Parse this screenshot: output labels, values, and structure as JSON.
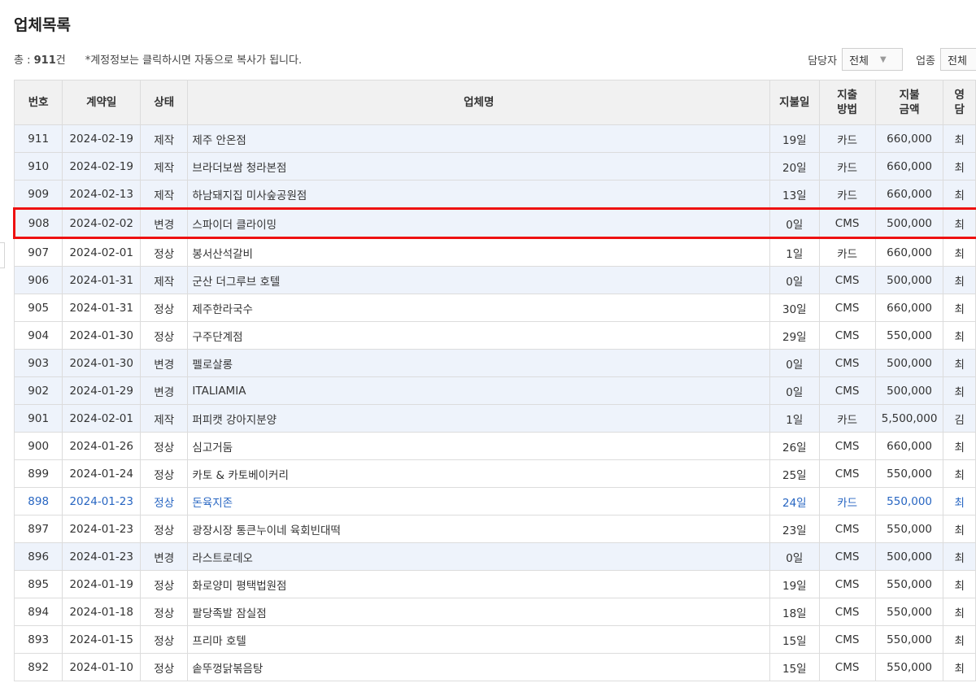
{
  "page_title": "업체목록",
  "summary": {
    "total_label": "총 : ",
    "total_count": "911",
    "total_unit": "건",
    "note": "*계정정보는 클릭하시면 자동으로 복사가 됩니다."
  },
  "filters": {
    "manager_label": "담당자",
    "manager_value": "전체",
    "industry_label": "업종",
    "industry_value": "전체"
  },
  "table": {
    "headers": [
      "번호",
      "계약일",
      "상태",
      "업체명",
      "지불일",
      "지출\n방법",
      "지불\n금액",
      "영\n담"
    ],
    "rows": [
      {
        "no": "911",
        "date": "2024-02-19",
        "status": "제작",
        "name": "제주 안온점",
        "payday": "19일",
        "method": "카드",
        "amount": "660,000",
        "manager": "최"
      },
      {
        "no": "910",
        "date": "2024-02-19",
        "status": "제작",
        "name": "브라더보쌈 청라본점",
        "payday": "20일",
        "method": "카드",
        "amount": "660,000",
        "manager": "최"
      },
      {
        "no": "909",
        "date": "2024-02-13",
        "status": "제작",
        "name": "하남돼지집 미사숲공원점",
        "payday": "13일",
        "method": "카드",
        "amount": "660,000",
        "manager": "최"
      },
      {
        "no": "908",
        "date": "2024-02-02",
        "status": "변경",
        "name": "스파이더 클라이밍",
        "payday": "0일",
        "method": "CMS",
        "amount": "500,000",
        "manager": "최"
      },
      {
        "no": "907",
        "date": "2024-02-01",
        "status": "정상",
        "name": "봉서산석갈비",
        "payday": "1일",
        "method": "카드",
        "amount": "660,000",
        "manager": "최"
      },
      {
        "no": "906",
        "date": "2024-01-31",
        "status": "제작",
        "name": "군산 더그루브 호텔",
        "payday": "0일",
        "method": "CMS",
        "amount": "500,000",
        "manager": "최"
      },
      {
        "no": "905",
        "date": "2024-01-31",
        "status": "정상",
        "name": "제주한라국수",
        "payday": "30일",
        "method": "CMS",
        "amount": "660,000",
        "manager": "최"
      },
      {
        "no": "904",
        "date": "2024-01-30",
        "status": "정상",
        "name": "구주단계점",
        "payday": "29일",
        "method": "CMS",
        "amount": "550,000",
        "manager": "최"
      },
      {
        "no": "903",
        "date": "2024-01-30",
        "status": "변경",
        "name": "펠로살롱",
        "payday": "0일",
        "method": "CMS",
        "amount": "500,000",
        "manager": "최"
      },
      {
        "no": "902",
        "date": "2024-01-29",
        "status": "변경",
        "name": "ITALIAMIA",
        "payday": "0일",
        "method": "CMS",
        "amount": "500,000",
        "manager": "최"
      },
      {
        "no": "901",
        "date": "2024-02-01",
        "status": "제작",
        "name": "퍼피캣 강아지분양",
        "payday": "1일",
        "method": "카드",
        "amount": "5,500,000",
        "manager": "김"
      },
      {
        "no": "900",
        "date": "2024-01-26",
        "status": "정상",
        "name": "심고거둠",
        "payday": "26일",
        "method": "CMS",
        "amount": "660,000",
        "manager": "최"
      },
      {
        "no": "899",
        "date": "2024-01-24",
        "status": "정상",
        "name": "카토 & 카토베이커리",
        "payday": "25일",
        "method": "CMS",
        "amount": "550,000",
        "manager": "최"
      },
      {
        "no": "898",
        "date": "2024-01-23",
        "status": "정상",
        "name": "돈육지존",
        "payday": "24일",
        "method": "카드",
        "amount": "550,000",
        "manager": "최"
      },
      {
        "no": "897",
        "date": "2024-01-23",
        "status": "정상",
        "name": "광장시장 통큰누이네 육회빈대떡",
        "payday": "23일",
        "method": "CMS",
        "amount": "550,000",
        "manager": "최"
      },
      {
        "no": "896",
        "date": "2024-01-23",
        "status": "변경",
        "name": "라스트로데오",
        "payday": "0일",
        "method": "CMS",
        "amount": "500,000",
        "manager": "최"
      },
      {
        "no": "895",
        "date": "2024-01-19",
        "status": "정상",
        "name": "화로양미 평택법원점",
        "payday": "19일",
        "method": "CMS",
        "amount": "550,000",
        "manager": "최"
      },
      {
        "no": "894",
        "date": "2024-01-18",
        "status": "정상",
        "name": "팔당족발 잠실점",
        "payday": "18일",
        "method": "CMS",
        "amount": "550,000",
        "manager": "최"
      },
      {
        "no": "893",
        "date": "2024-01-15",
        "status": "정상",
        "name": "프리마 호텔",
        "payday": "15일",
        "method": "CMS",
        "amount": "550,000",
        "manager": "최"
      },
      {
        "no": "892",
        "date": "2024-01-10",
        "status": "정상",
        "name": "솥뚜껑닭볶음탕",
        "payday": "15일",
        "method": "CMS",
        "amount": "550,000",
        "manager": "최"
      }
    ]
  },
  "colors": {
    "highlight_border": "#ee1111",
    "row_blue_bg": "#eef3fb",
    "link_text": "#2866c2",
    "header_bg": "#f1f1f1"
  }
}
